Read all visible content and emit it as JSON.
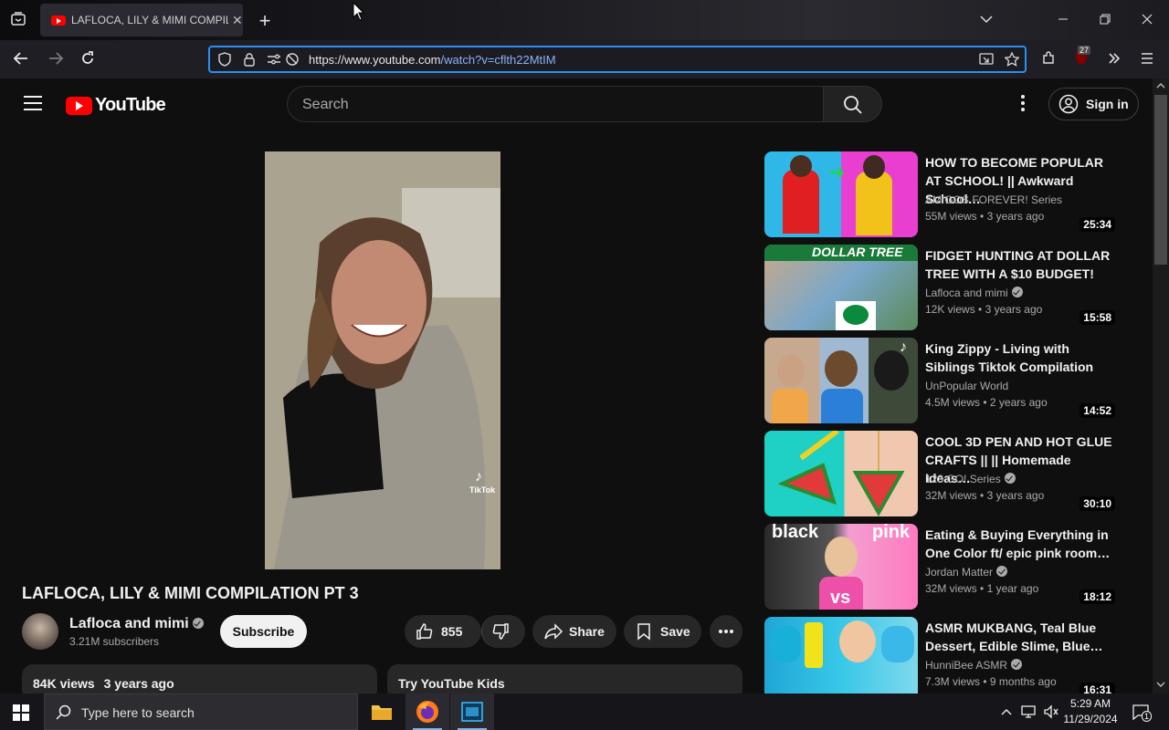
{
  "browser": {
    "tab_title": "LAFLOCA, LILY & MIMI COMPILATION PT 3",
    "tab_close": "✕",
    "new_tab": "+",
    "url_scheme_and_host": "https://www.youtube.com",
    "url_path": "/watch?v=cflth22MtIM",
    "extension_badge": "27"
  },
  "youtube": {
    "logo_text": "YouTube",
    "search_placeholder": "Search",
    "sign_in": "Sign in",
    "video": {
      "title": "LAFLOCA, LILY & MIMI COMPILATION PT 3",
      "channel": "Lafloca and mimi",
      "subscribers": "3.21M subscribers",
      "subscribe": "Subscribe",
      "likes": "855",
      "share": "Share",
      "save": "Save",
      "views": "84K views",
      "age": "3 years ago",
      "kids_promo": "Try YouTube Kids",
      "watermark": "TikTok"
    },
    "recommendations": [
      {
        "title": "HOW TO BECOME POPULAR AT SCHOOL! || Awkward School…",
        "channel": "AMIGOS FOREVER! Series",
        "verified": false,
        "views": "55M views",
        "age": "3 years ago",
        "duration": "25:34"
      },
      {
        "title": "FIDGET HUNTING AT DOLLAR TREE WITH A $10 BUDGET!",
        "channel": "Lafloca and mimi",
        "verified": true,
        "views": "12K views",
        "age": "3 years ago",
        "duration": "15:58",
        "thumb_text": "DOLLAR TREE"
      },
      {
        "title": "King Zippy - Living with Siblings Tiktok Compilation",
        "channel": "UnPopular World",
        "verified": false,
        "views": "4.5M views",
        "age": "2 years ago",
        "duration": "14:52"
      },
      {
        "title": "COOL 3D PEN AND HOT GLUE CRAFTS || || Homemade Ideas…",
        "channel": "123 GO! Series",
        "verified": true,
        "views": "32M views",
        "age": "3 years ago",
        "duration": "30:10"
      },
      {
        "title": "Eating & Buying Everything in One Color ft/ epic pink room…",
        "channel": "Jordan Matter",
        "verified": true,
        "views": "32M views",
        "age": "1 year ago",
        "duration": "18:12",
        "thumb_text_left": "black",
        "thumb_text_right": "pink",
        "thumb_text_vs": "vs"
      },
      {
        "title": "ASMR MUKBANG, Teal Blue Dessert, Edible Slime, Blue…",
        "channel": "HunniBee ASMR",
        "verified": true,
        "views": "7.3M views",
        "age": "9 months ago",
        "duration": "16:31"
      }
    ]
  },
  "taskbar": {
    "search_placeholder": "Type here to search",
    "time": "5:29 AM",
    "date": "11/29/2024",
    "notification_count": "1"
  },
  "colors": {
    "yt_red": "#ff0000",
    "url_focus": "#2a8ff0",
    "background": "#0f0f0f"
  }
}
